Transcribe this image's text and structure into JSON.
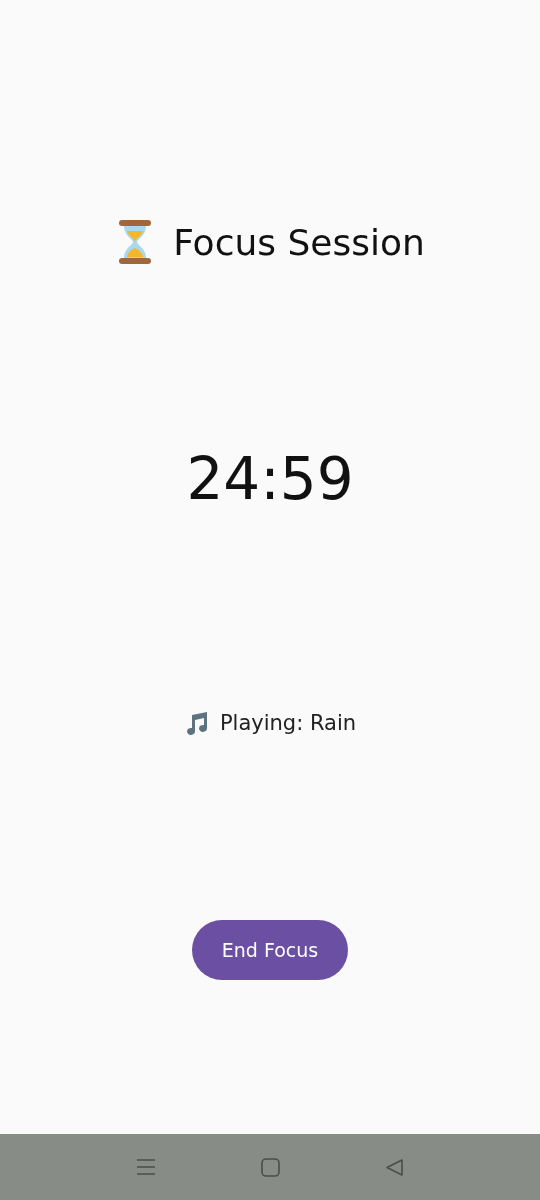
{
  "title": "Focus Session",
  "timer": "24:59",
  "now_playing": "Playing: Rain",
  "button": {
    "label": "End Focus"
  },
  "nav_bar": {
    "buttons": [
      {
        "kind": "menu"
      },
      {
        "kind": "home"
      },
      {
        "kind": "back"
      }
    ]
  }
}
